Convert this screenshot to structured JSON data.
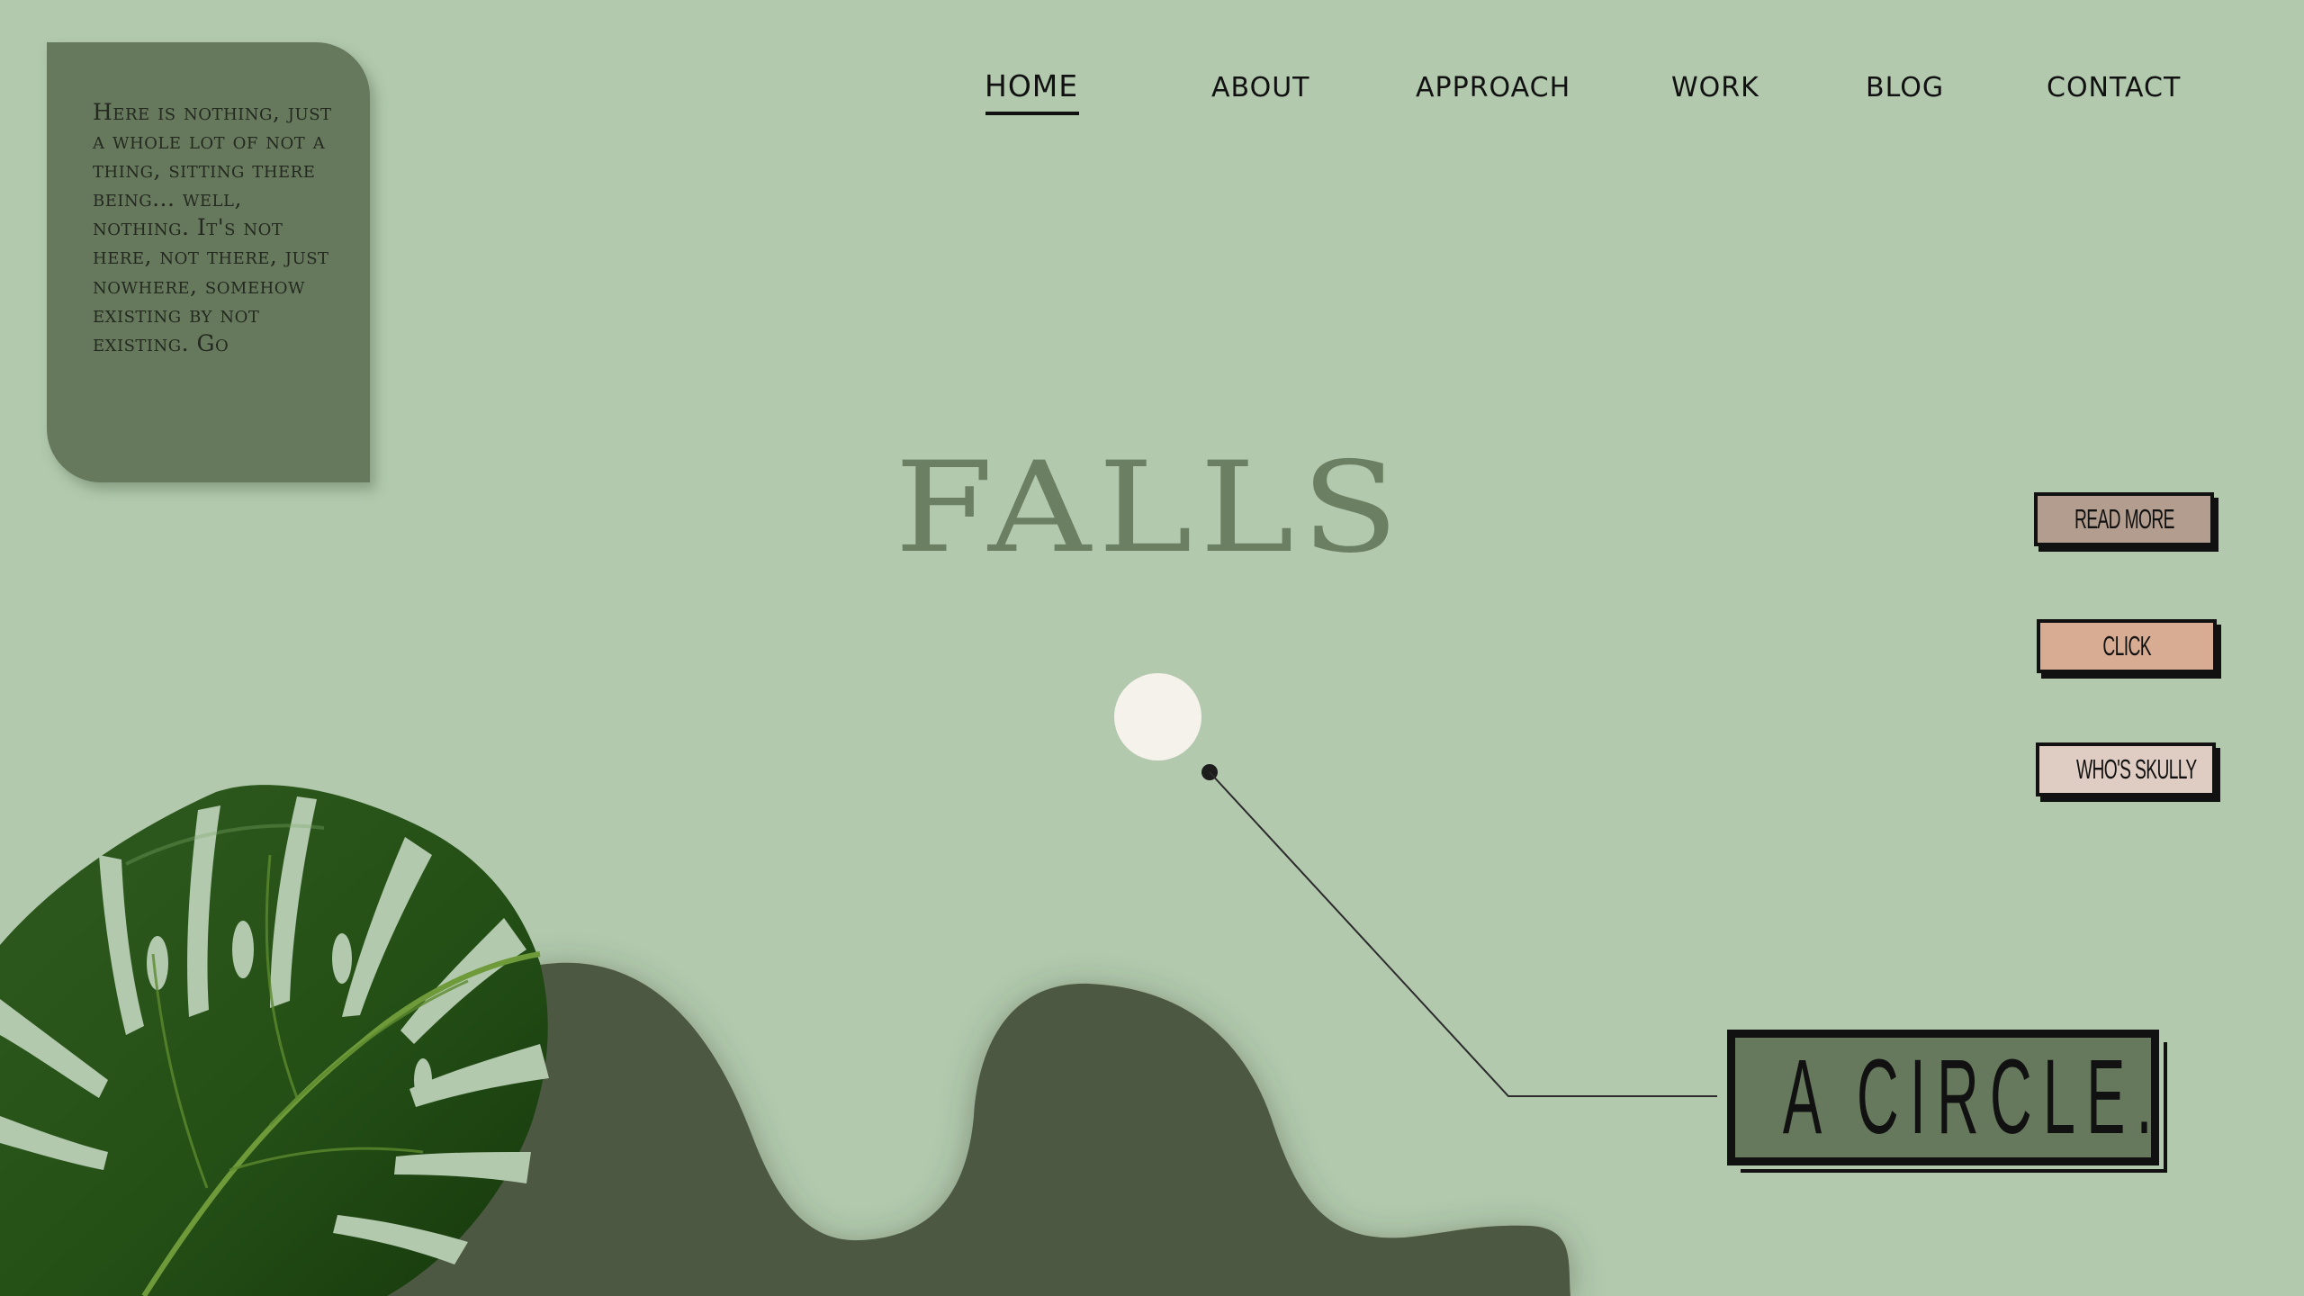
{
  "info_card": {
    "text": "Here is nothing, just a whole lot of not a thing, sitting there being... well, nothing. It's not here, not there, just nowhere, somehow existing by not existing. Go"
  },
  "nav": {
    "items": [
      {
        "label": "HOME",
        "active": true
      },
      {
        "label": "ABOUT",
        "active": false
      },
      {
        "label": "APPROACH",
        "active": false
      },
      {
        "label": "WORK",
        "active": false
      },
      {
        "label": "BLOG",
        "active": false
      },
      {
        "label": "CONTACT",
        "active": false
      }
    ]
  },
  "hero": {
    "title": "FALLS"
  },
  "buttons": {
    "read_more": "READ MORE",
    "click": "CLICK",
    "whos_skully": "WHO'S SKULLY"
  },
  "callout": {
    "label": "A CIRCLE."
  },
  "colors": {
    "background": "#b2c9ae",
    "card": "#67795d",
    "blob": "#4d5942",
    "title": "#6b7f62",
    "read_more": "#b29d8e",
    "click": "#d8ab93",
    "whos_skully": "#dfcdc3",
    "dot": "#f5f1eb"
  },
  "icons": {
    "leaf": "monstera-leaf-icon",
    "dot": "circle-dot-icon"
  }
}
